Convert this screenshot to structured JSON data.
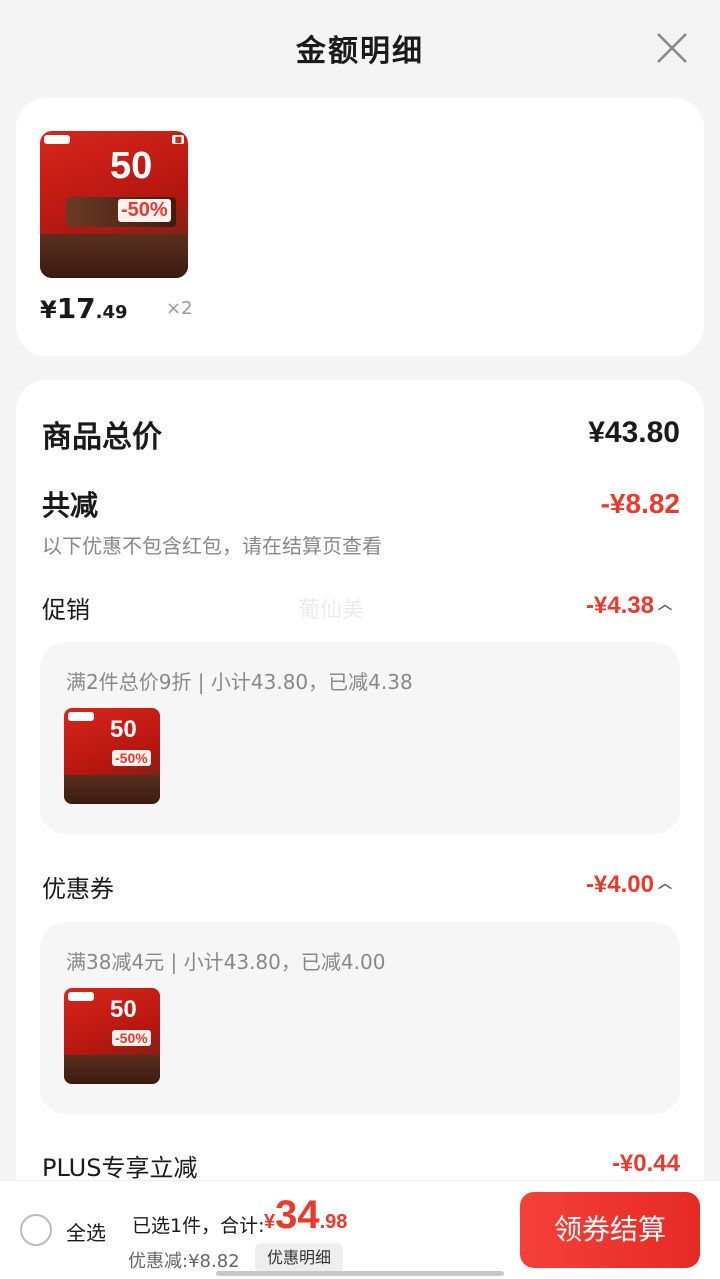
{
  "header": {
    "title": "金额明细"
  },
  "product": {
    "price_currency": "¥",
    "price_int": "17",
    "price_dec": ".49",
    "qty": "×2",
    "thumb_text": "50",
    "thumb_percent": "-50%"
  },
  "summary": {
    "total_label": "商品总价",
    "total_value": "¥43.80",
    "reduce_label": "共减",
    "reduce_value": "-¥8.82",
    "reduce_note": "以下优惠不包含红包，请在结算页查看"
  },
  "promotion": {
    "label": "促销",
    "value": "-¥4.38",
    "detail": "满2件总价9折 | 小计43.80，已减4.38"
  },
  "coupon": {
    "label": "优惠券",
    "value": "-¥4.00",
    "detail": "满38减4元 | 小计43.80，已减4.00"
  },
  "plus": {
    "label": "PLUS专享立减",
    "value": "-¥0.44"
  },
  "watermark": "葡仙美",
  "bottom": {
    "select_all": "全选",
    "selected_info": "已选1件，合计:",
    "total_currency": "¥",
    "total_int": "34",
    "total_dec": ".98",
    "discount_info": "优惠减:¥8.82",
    "detail_link": "优惠明细",
    "checkout": "领券结算"
  },
  "colors": {
    "accent": "#e83a2d",
    "background": "#f4f4f4"
  }
}
